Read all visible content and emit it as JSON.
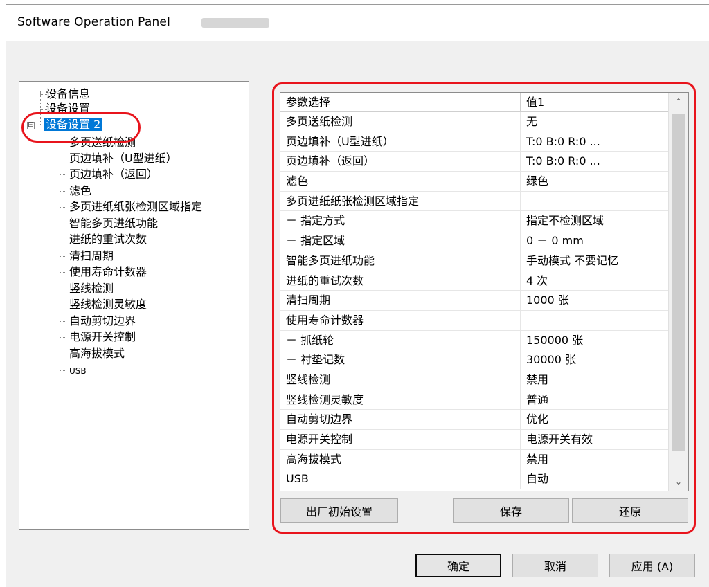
{
  "window": {
    "title": "Software Operation Panel"
  },
  "tree": {
    "items": [
      {
        "label": "设备信息"
      },
      {
        "label": "设备设置"
      },
      {
        "label": "设备设置 2"
      },
      {
        "label": "多页送纸检测"
      },
      {
        "label": "页边填补（U型进纸）"
      },
      {
        "label": "页边填补（返回）"
      },
      {
        "label": "滤色"
      },
      {
        "label": "多页进纸纸张检测区域指定"
      },
      {
        "label": "智能多页进纸功能"
      },
      {
        "label": "进纸的重试次数"
      },
      {
        "label": "清扫周期"
      },
      {
        "label": "使用寿命计数器"
      },
      {
        "label": "竖线检测"
      },
      {
        "label": "竖线检测灵敏度"
      },
      {
        "label": "自动剪切边界"
      },
      {
        "label": "电源开关控制"
      },
      {
        "label": "高海拔模式"
      },
      {
        "label": "USB"
      }
    ],
    "expander_symbol": "⊟"
  },
  "table": {
    "col_param": "参数选择",
    "col_value": "值1",
    "rows": [
      {
        "param": "多页送纸检测",
        "value": "无"
      },
      {
        "param": "页边填补（U型进纸）",
        "value": "T:0  B:0  R:0  ..."
      },
      {
        "param": "页边填补（返回）",
        "value": "T:0  B:0  R:0  ..."
      },
      {
        "param": "滤色",
        "value": "绿色"
      },
      {
        "param": "多页进纸纸张检测区域指定",
        "value": ""
      },
      {
        "param": " － 指定方式",
        "value": "指定不检测区域"
      },
      {
        "param": " － 指定区域",
        "value": "0 － 0 mm"
      },
      {
        "param": "智能多页进纸功能",
        "value": "手动模式  不要记忆"
      },
      {
        "param": "进纸的重试次数",
        "value": "4 次"
      },
      {
        "param": "清扫周期",
        "value": "1000 张"
      },
      {
        "param": "使用寿命计数器",
        "value": ""
      },
      {
        "param": " － 抓纸轮",
        "value": "150000 张"
      },
      {
        "param": " － 衬垫记数",
        "value": "30000 张"
      },
      {
        "param": "竖线检测",
        "value": "禁用"
      },
      {
        "param": "竖线检测灵敏度",
        "value": "普通"
      },
      {
        "param": "自动剪切边界",
        "value": "优化"
      },
      {
        "param": "电源开关控制",
        "value": "电源开关有效"
      },
      {
        "param": "高海拔模式",
        "value": "禁用"
      },
      {
        "param": "USB",
        "value": "自动"
      }
    ],
    "scroll_up": "⌃",
    "scroll_down": "⌄"
  },
  "panel_buttons": {
    "factory_reset": "出厂初始设置",
    "save": "保存",
    "restore": "还原"
  },
  "dialog_buttons": {
    "ok": "确定",
    "cancel": "取消",
    "apply": "应用 (A)"
  }
}
